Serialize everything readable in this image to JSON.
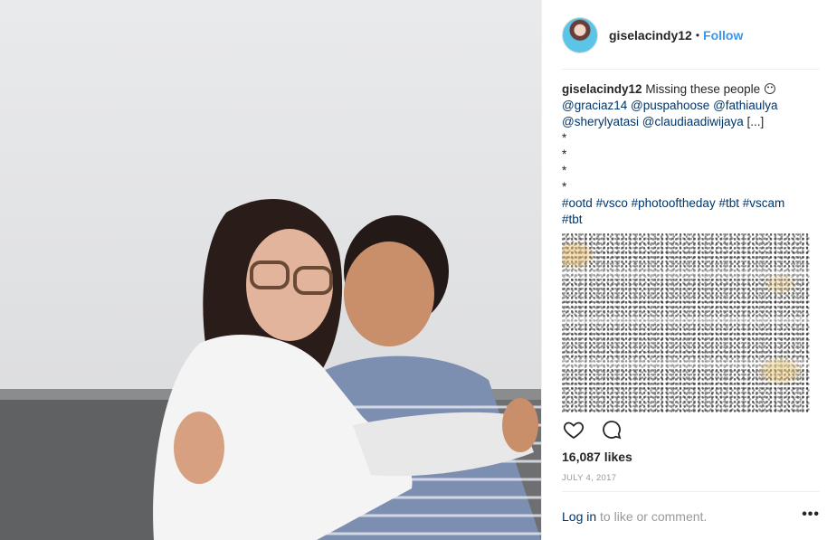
{
  "post": {
    "username": "giselacindy12",
    "follow_separator": "•",
    "follow_label": "Follow",
    "caption": {
      "username": "giselacindy12",
      "text": "Missing these people",
      "emoji": "😶",
      "mentions_line1": [
        "@graciaz14",
        "@puspahoose",
        "@fathiaulya"
      ],
      "mentions_line2": [
        "@sherylyatasi",
        "@claudiaadiwijaya"
      ],
      "ellipsis": "[...]",
      "stars": [
        "*",
        "*",
        "*",
        "*"
      ],
      "hashtags_line1": [
        "#ootd",
        "#vsco",
        "#photooftheday",
        "#tbt",
        "#vscam"
      ],
      "hashtags_line2": [
        "#tbt"
      ]
    },
    "likes": "16,087 likes",
    "date": "JULY 4, 2017",
    "login_link": "Log in",
    "login_text": "to like or comment.",
    "more_label": "•••"
  },
  "icons": {
    "like": "heart-icon",
    "comment": "comment-icon",
    "avatar": "profile-avatar"
  },
  "colors": {
    "follow": "#3897f0",
    "link": "#003569",
    "muted": "#999999",
    "text": "#262626"
  }
}
